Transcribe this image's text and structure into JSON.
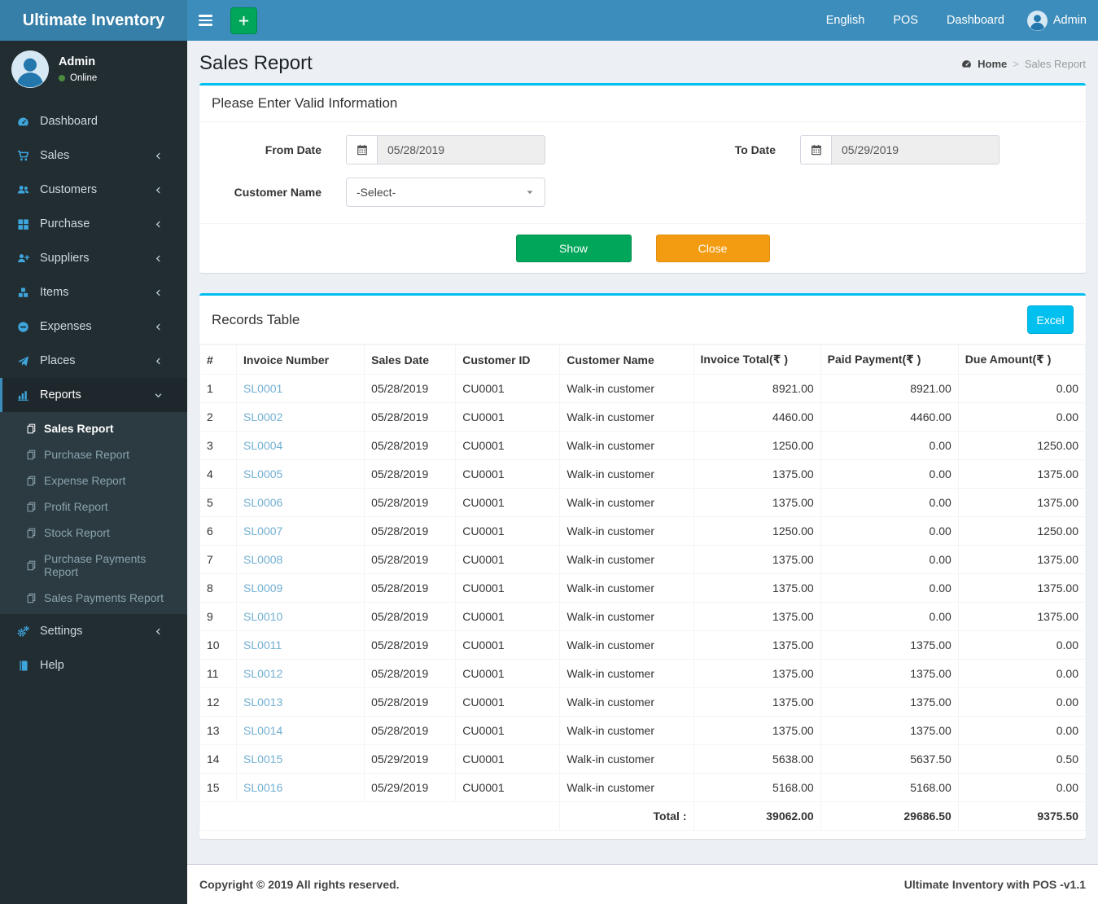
{
  "app": {
    "title": "Ultimate Inventory",
    "copyright": "Copyright © 2019 All rights reserved.",
    "version_label": "Ultimate Inventory with POS -v1.1"
  },
  "navbar": {
    "language_label": "English",
    "pos_label": "POS",
    "dashboard_label": "Dashboard",
    "user_label": "Admin"
  },
  "sidebar": {
    "user": {
      "name": "Admin",
      "status": "Online"
    },
    "items": [
      {
        "label": "Dashboard",
        "icon": "dashboard-icon"
      },
      {
        "label": "Sales",
        "icon": "cart-icon",
        "chevron": "left"
      },
      {
        "label": "Customers",
        "icon": "users-icon",
        "chevron": "left"
      },
      {
        "label": "Purchase",
        "icon": "grid-icon",
        "chevron": "left"
      },
      {
        "label": "Suppliers",
        "icon": "user-plus-icon",
        "chevron": "left"
      },
      {
        "label": "Items",
        "icon": "cubes-icon",
        "chevron": "left"
      },
      {
        "label": "Expenses",
        "icon": "minus-circle-icon",
        "chevron": "left"
      },
      {
        "label": "Places",
        "icon": "paper-plane-icon",
        "chevron": "left"
      },
      {
        "label": "Reports",
        "icon": "bar-chart-icon",
        "chevron": "down",
        "active": true,
        "submenu": [
          {
            "label": "Sales Report",
            "active": true
          },
          {
            "label": "Purchase Report"
          },
          {
            "label": "Expense Report"
          },
          {
            "label": "Profit Report"
          },
          {
            "label": "Stock Report"
          },
          {
            "label": "Purchase Payments Report"
          },
          {
            "label": "Sales Payments Report"
          }
        ]
      },
      {
        "label": "Settings",
        "icon": "gears-icon",
        "chevron": "left"
      },
      {
        "label": "Help",
        "icon": "book-icon"
      }
    ]
  },
  "page": {
    "title": "Sales Report",
    "breadcrumb": {
      "home": "Home",
      "separator": ">",
      "current": "Sales Report"
    }
  },
  "filter": {
    "panel_title": "Please Enter Valid Information",
    "from_date": {
      "label": "From Date",
      "value": "05/28/2019"
    },
    "to_date": {
      "label": "To Date",
      "value": "05/29/2019"
    },
    "customer": {
      "label": "Customer Name",
      "value": "-Select-"
    },
    "show_label": "Show",
    "close_label": "Close"
  },
  "records": {
    "panel_title": "Records Table",
    "excel_label": "Excel",
    "columns": [
      "#",
      "Invoice Number",
      "Sales Date",
      "Customer ID",
      "Customer Name",
      "Invoice Total(₹ )",
      "Paid Payment(₹ )",
      "Due Amount(₹ )"
    ],
    "rows": [
      [
        "1",
        "SL0001",
        "05/28/2019",
        "CU0001",
        "Walk-in customer",
        "8921.00",
        "8921.00",
        "0.00"
      ],
      [
        "2",
        "SL0002",
        "05/28/2019",
        "CU0001",
        "Walk-in customer",
        "4460.00",
        "4460.00",
        "0.00"
      ],
      [
        "3",
        "SL0004",
        "05/28/2019",
        "CU0001",
        "Walk-in customer",
        "1250.00",
        "0.00",
        "1250.00"
      ],
      [
        "4",
        "SL0005",
        "05/28/2019",
        "CU0001",
        "Walk-in customer",
        "1375.00",
        "0.00",
        "1375.00"
      ],
      [
        "5",
        "SL0006",
        "05/28/2019",
        "CU0001",
        "Walk-in customer",
        "1375.00",
        "0.00",
        "1375.00"
      ],
      [
        "6",
        "SL0007",
        "05/28/2019",
        "CU0001",
        "Walk-in customer",
        "1250.00",
        "0.00",
        "1250.00"
      ],
      [
        "7",
        "SL0008",
        "05/28/2019",
        "CU0001",
        "Walk-in customer",
        "1375.00",
        "0.00",
        "1375.00"
      ],
      [
        "8",
        "SL0009",
        "05/28/2019",
        "CU0001",
        "Walk-in customer",
        "1375.00",
        "0.00",
        "1375.00"
      ],
      [
        "9",
        "SL0010",
        "05/28/2019",
        "CU0001",
        "Walk-in customer",
        "1375.00",
        "0.00",
        "1375.00"
      ],
      [
        "10",
        "SL0011",
        "05/28/2019",
        "CU0001",
        "Walk-in customer",
        "1375.00",
        "1375.00",
        "0.00"
      ],
      [
        "11",
        "SL0012",
        "05/28/2019",
        "CU0001",
        "Walk-in customer",
        "1375.00",
        "1375.00",
        "0.00"
      ],
      [
        "12",
        "SL0013",
        "05/28/2019",
        "CU0001",
        "Walk-in customer",
        "1375.00",
        "1375.00",
        "0.00"
      ],
      [
        "13",
        "SL0014",
        "05/28/2019",
        "CU0001",
        "Walk-in customer",
        "1375.00",
        "1375.00",
        "0.00"
      ],
      [
        "14",
        "SL0015",
        "05/29/2019",
        "CU0001",
        "Walk-in customer",
        "5638.00",
        "5637.50",
        "0.50"
      ],
      [
        "15",
        "SL0016",
        "05/29/2019",
        "CU0001",
        "Walk-in customer",
        "5168.00",
        "5168.00",
        "0.00"
      ]
    ],
    "total": {
      "label": "Total :",
      "invoice_total": "39062.00",
      "paid_payment": "29686.50",
      "due_amount": "9375.50"
    }
  },
  "colors": {
    "navbar": "#3c8dbc",
    "logo_bg": "#367fa9",
    "sidebar_bg": "#222d32",
    "submenu_bg": "#2c3b41",
    "accent_cyan": "#00c0ef",
    "green": "#00a65a",
    "orange": "#f39c12",
    "content_bg": "#ecf0f5",
    "link": "#72afd2",
    "sidebar_icon": "#3ea6dd",
    "online_dot": "#4b8b3b"
  }
}
